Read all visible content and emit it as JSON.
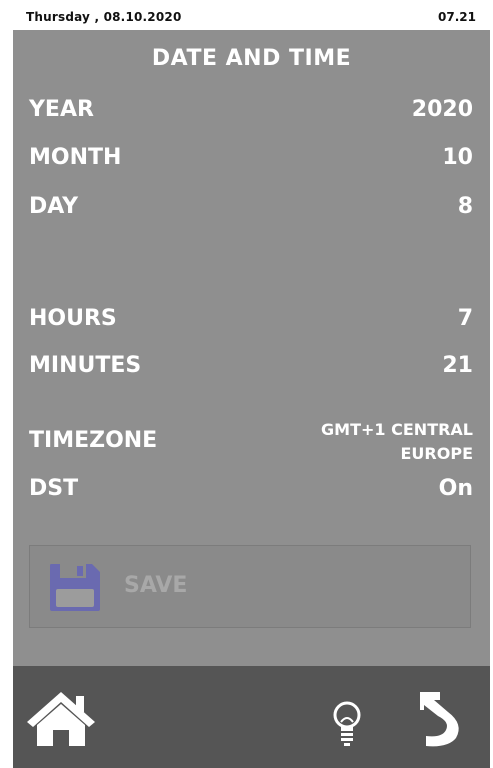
{
  "status": {
    "date": "Thursday , 08.10.2020",
    "time": "07.21"
  },
  "title": "DATE AND TIME",
  "rows": {
    "year": {
      "label": "YEAR",
      "value": "2020"
    },
    "month": {
      "label": "MONTH",
      "value": "10"
    },
    "day": {
      "label": "DAY",
      "value": "8"
    },
    "hours": {
      "label": "HOURS",
      "value": "7"
    },
    "minutes": {
      "label": "MINUTES",
      "value": "21"
    },
    "timezone": {
      "label": "TIMEZONE",
      "value_line1": "GMT+1 CENTRAL",
      "value_line2": "EUROPE"
    },
    "dst": {
      "label": "DST",
      "value": "On"
    }
  },
  "save_button": {
    "label": "SAVE",
    "icon": "floppy-disk-icon"
  },
  "bottom_bar": {
    "home_icon": "home-icon",
    "light_icon": "lightbulb-icon",
    "back_icon": "back-arrow-icon"
  },
  "colors": {
    "panel": "#8f8f8f",
    "bottom_bar": "#555555",
    "save_icon": "#6a6ab0"
  }
}
